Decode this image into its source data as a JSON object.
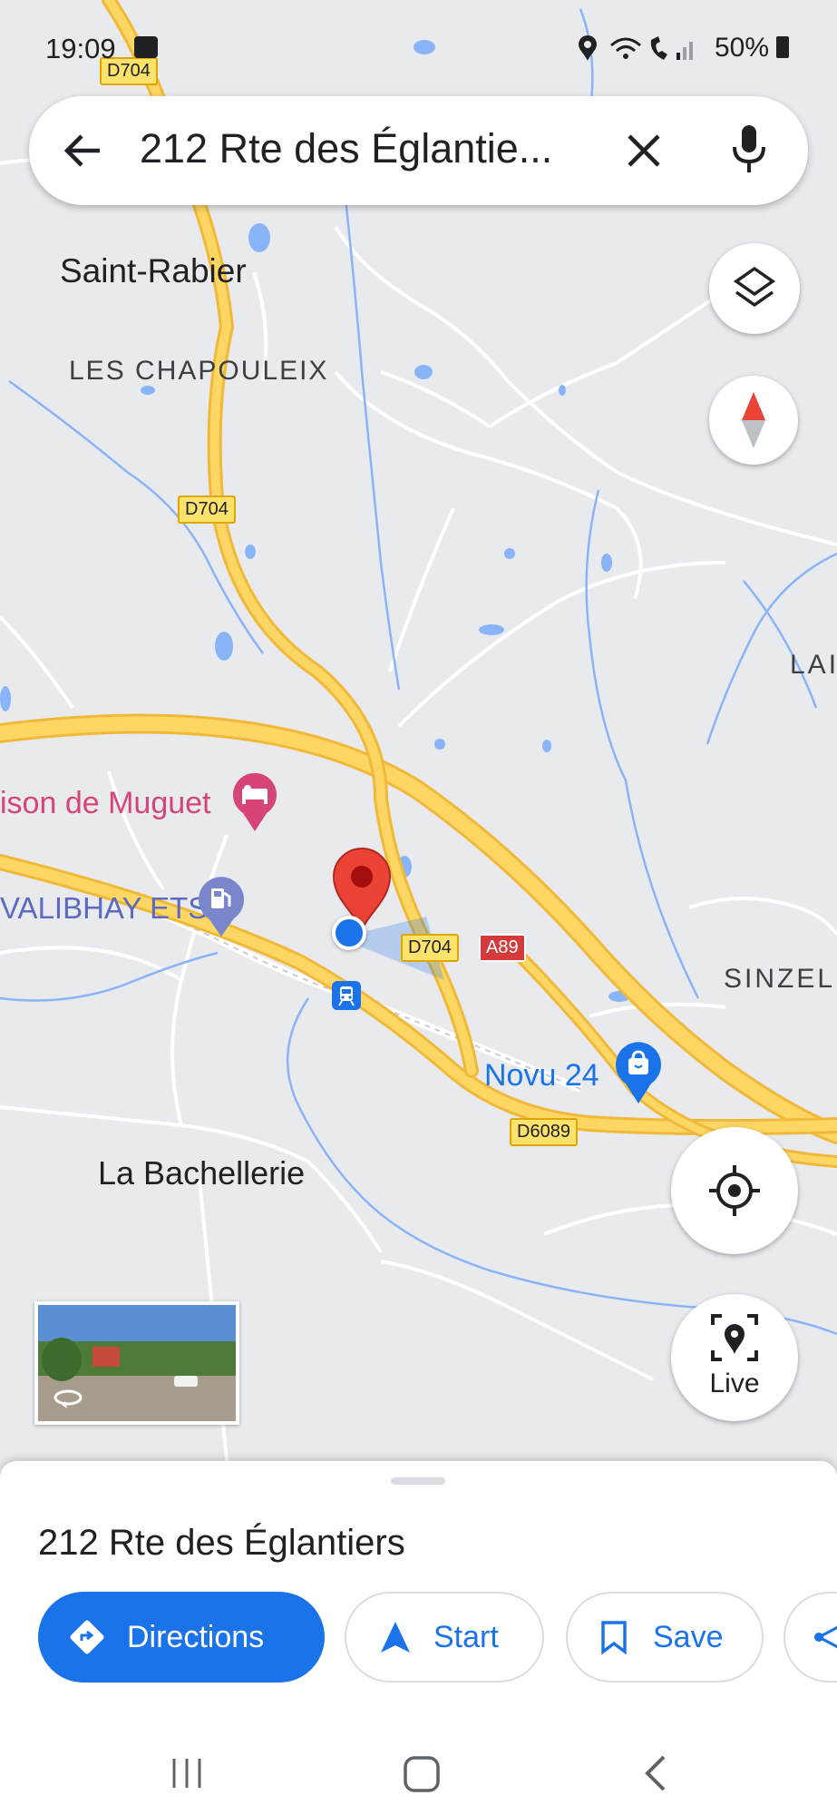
{
  "status": {
    "time": "19:09",
    "battery": "50%"
  },
  "search": {
    "query": "212 Rte des Églantie..."
  },
  "map": {
    "places": {
      "saint_rabier": "Saint-Rabier",
      "chapouleix": "LES CHAPOULEIX",
      "la_bachellerie": "La Bachellerie",
      "sinzel": "SINZEL",
      "lar": "LAI",
      "muguet": "ison de Muguet",
      "valibhay": "VALIBHAY ETS",
      "novu": "Novu 24"
    },
    "roads": {
      "d704_top": "D704",
      "d704_mid": "D704",
      "d704_low": "D704",
      "a89": "A89",
      "d6089": "D6089"
    },
    "colors": {
      "water": "#8ab4f8",
      "road": "#fdd663",
      "road_edge": "#f0b93a",
      "pin": "#ea4335",
      "poi_pink": "#d6447a",
      "poi_fuel": "#7986cb",
      "blue": "#1a73e8"
    }
  },
  "controls": {
    "live_label": "Live"
  },
  "sheet": {
    "title": "212 Rte des Églantiers",
    "directions_label": "Directions",
    "start_label": "Start",
    "save_label": "Save"
  }
}
